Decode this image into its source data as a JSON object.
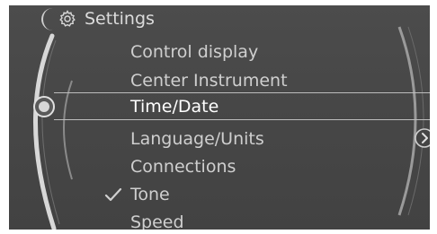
{
  "header": {
    "icon": "gear-icon",
    "title": "Settings"
  },
  "menu": {
    "items": [
      {
        "label": "Control display",
        "selected": false,
        "checked": false
      },
      {
        "label": "Center Instrument",
        "selected": false,
        "checked": false
      },
      {
        "label": "Time/Date",
        "selected": true,
        "checked": false
      },
      {
        "label": "Language/Units",
        "selected": false,
        "checked": false
      },
      {
        "label": "Connections",
        "selected": false,
        "checked": false
      },
      {
        "label": "Tone",
        "selected": false,
        "checked": true
      },
      {
        "label": "Speed",
        "selected": false,
        "checked": false
      }
    ]
  },
  "icons": {
    "selector": "selector-knob-icon",
    "next": "chevron-right-icon",
    "check": "checkmark-icon"
  },
  "colors": {
    "background": "#474747",
    "text": "#cfcfcf",
    "selected_text": "#ffffff",
    "accent_line": "#bdbdbd"
  }
}
